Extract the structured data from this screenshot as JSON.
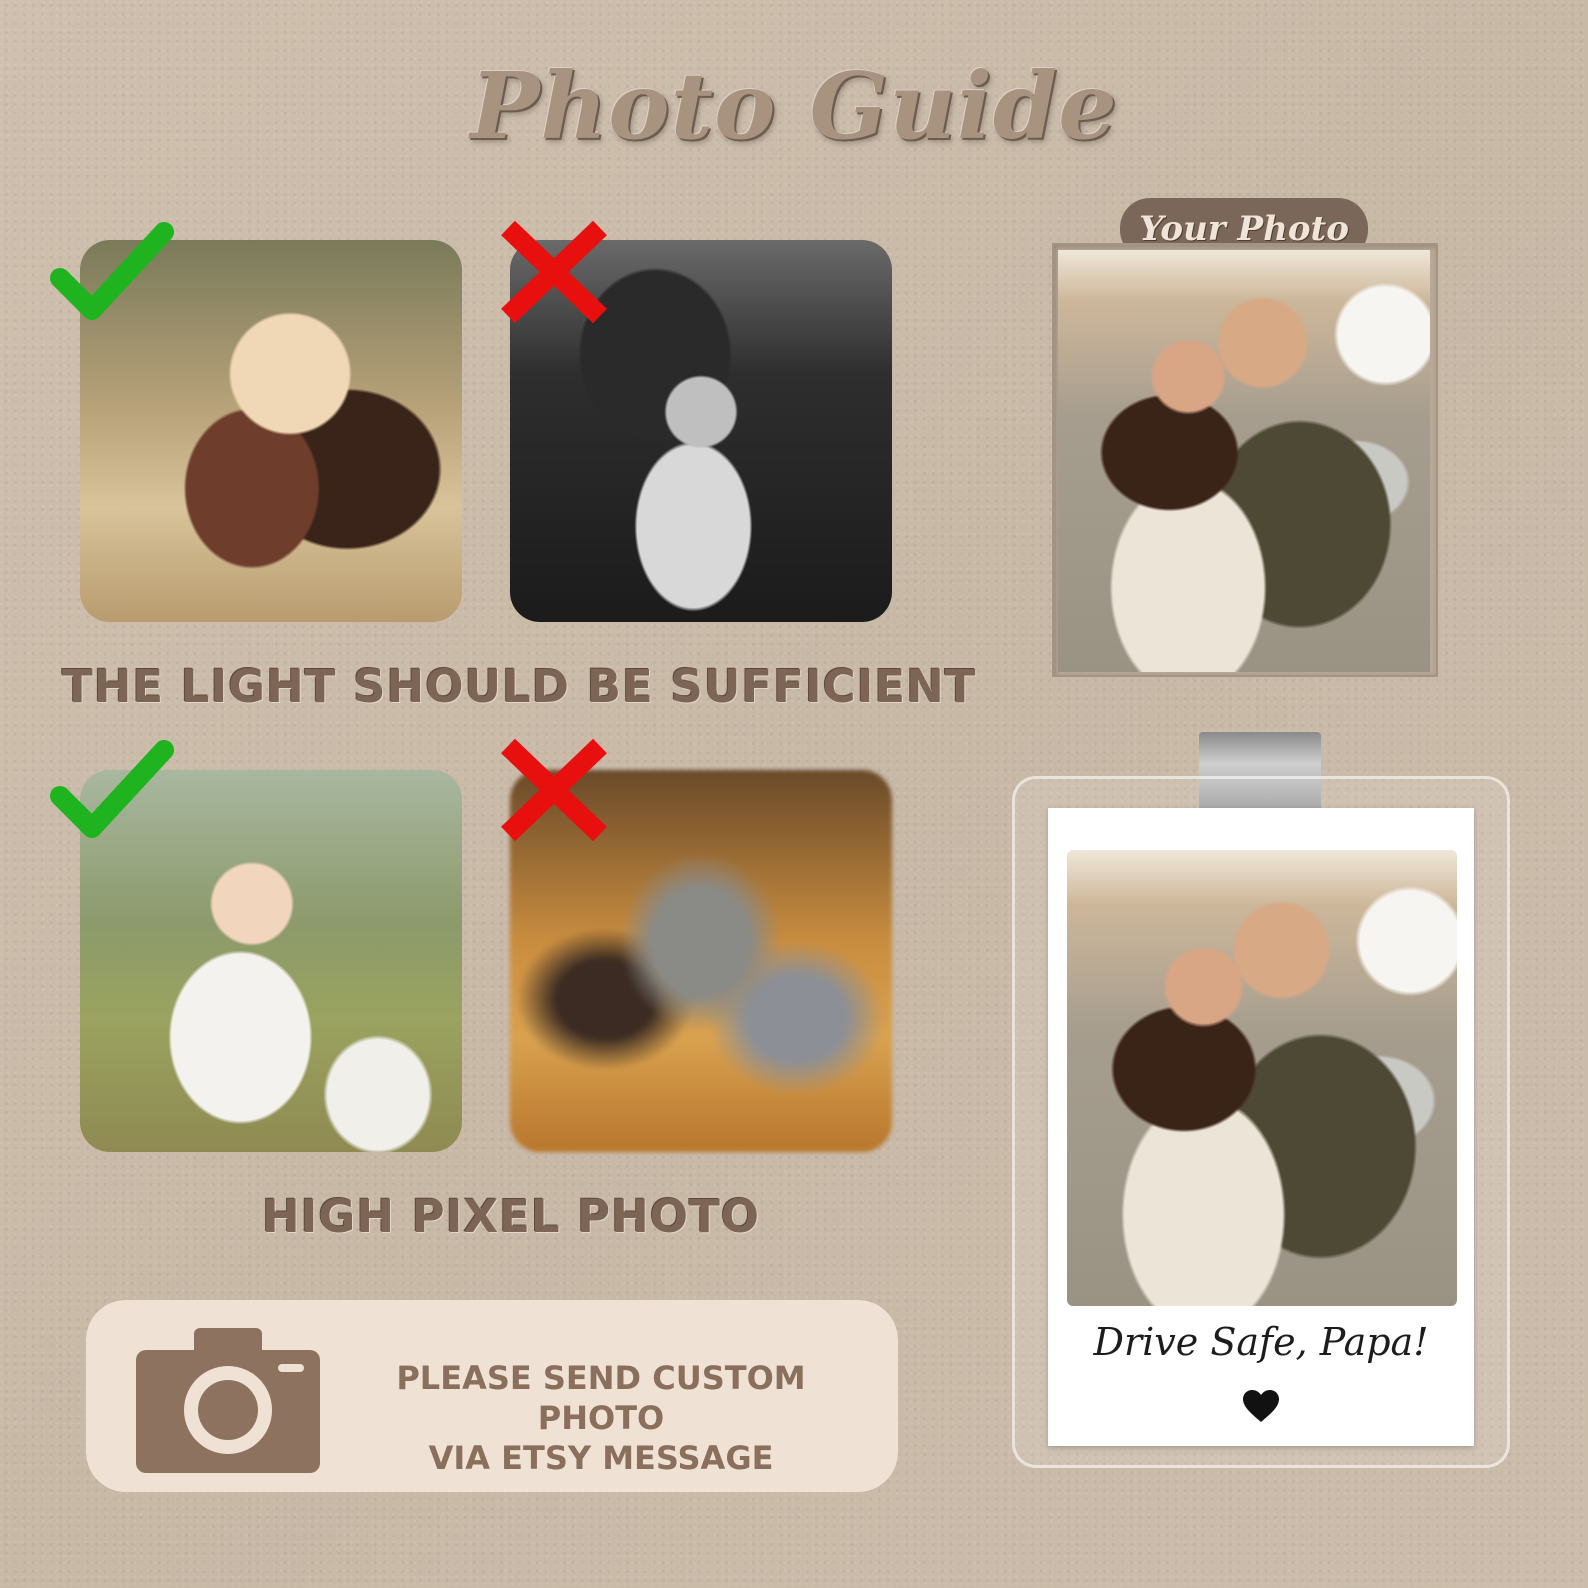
{
  "title": "Photo Guide",
  "sections": {
    "light_caption": "THE LIGHT SHOULD BE SUFFICIENT",
    "pixel_caption": "HIGH PIXEL PHOTO"
  },
  "marks": {
    "good": "check-icon",
    "bad": "cross-icon",
    "good_color": "#1fb31f",
    "bad_color": "#e80f0f"
  },
  "note": {
    "line1": "PLEASE SEND CUSTOM PHOTO",
    "line2": "VIA ETSY MESSAGE",
    "icon": "camera-icon"
  },
  "your_photo_label": "Your Photo",
  "preview": {
    "message": "Drive Safe, Papa!",
    "icon": "heart-icon"
  },
  "colors": {
    "background": "#cbbbaa",
    "text_brown": "#7d6555",
    "panel": "#efe2d4"
  }
}
